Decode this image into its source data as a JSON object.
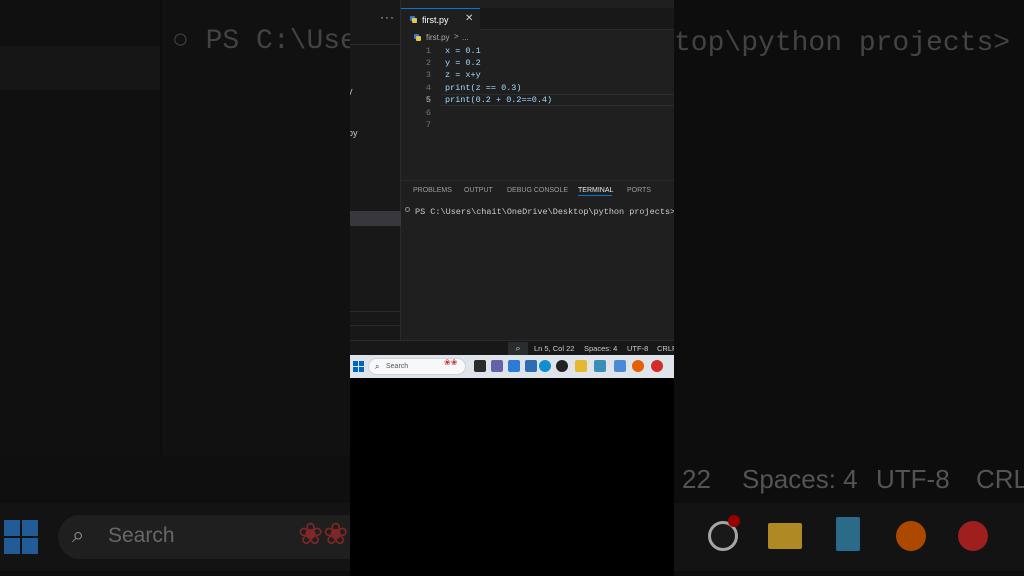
{
  "editor": {
    "tab": {
      "label": "first.py",
      "close": "✕"
    },
    "more_actions": "···",
    "breadcrumb": {
      "file": "first.py",
      "sep": ">",
      "more": "..."
    },
    "lines": [
      {
        "num": "1",
        "code": "x = 0.1"
      },
      {
        "num": "2",
        "code": "y = 0.2"
      },
      {
        "num": "3",
        "code": "z = x+y"
      },
      {
        "num": "4",
        "code": "print(z == 0.3)"
      },
      {
        "num": "5",
        "code": "print(0.2 + 0.2==0.4)"
      },
      {
        "num": "6",
        "code": ""
      },
      {
        "num": "7",
        "code": ""
      }
    ]
  },
  "explorer": {
    "items": [
      "y",
      "py"
    ]
  },
  "panel": {
    "tabs": [
      "PROBLEMS",
      "OUTPUT",
      "DEBUG CONSOLE",
      "TERMINAL",
      "PORTS"
    ],
    "active_tab": "TERMINAL",
    "terminal_prompt": "PS C:\\Users\\chait\\OneDrive\\Desktop\\python projects>"
  },
  "statusbar": {
    "position": "Ln 5, Col 22",
    "indent": "Spaces: 4",
    "encoding": "UTF-8",
    "eol": "CRLF"
  },
  "taskbar": {
    "search_placeholder": "Search",
    "apps": [
      "file-explorer-icon",
      "teams-icon",
      "photos-icon",
      "terminal-icon",
      "edge-icon",
      "obs-icon",
      "folder-icon",
      "notepad-icon",
      "firefox-icon",
      "wps-icon"
    ]
  },
  "background": {
    "terminal_left": "PS C:\\Users",
    "terminal_right": "top\\python projects>",
    "status_col": "22",
    "status_indent": "Spaces: 4",
    "status_encoding": "UTF-8",
    "status_eol": "CRLF",
    "search_label": "Search"
  },
  "colors": {
    "accent": "#0078d4",
    "keyword_text": "#9cdcfe",
    "taskbar": "#dfe3ea"
  }
}
